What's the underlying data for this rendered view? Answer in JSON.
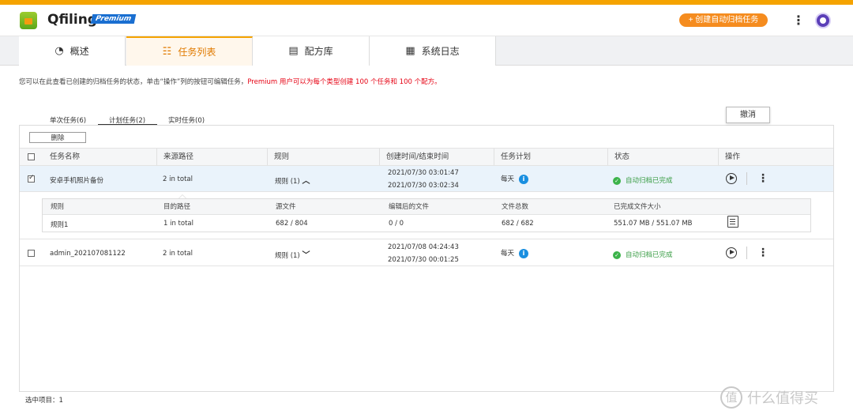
{
  "header": {
    "app_name": "Qfiling",
    "badge": "Premium",
    "create_button": "+ 创建自动归档任务"
  },
  "tabs": [
    {
      "label": "概述",
      "icon": "gauge-icon"
    },
    {
      "label": "任务列表",
      "icon": "task-list-icon",
      "active": true
    },
    {
      "label": "配方库",
      "icon": "recipe-library-icon"
    },
    {
      "label": "系统日志",
      "icon": "log-icon"
    }
  ],
  "description": {
    "normal": "您可以在此查看已创建的归档任务的状态，单击“操作”列的按钮可编辑任务，",
    "highlight": "Premium 用户可以为每个类型创建 100 个任务和 100 个配方。"
  },
  "subtabs": [
    {
      "label": "单次任务(6)"
    },
    {
      "label": "计划任务(2)",
      "active": true
    },
    {
      "label": "实时任务(0)"
    }
  ],
  "toolbar": {
    "delete_label": "删除"
  },
  "table": {
    "headers": [
      "任务名称",
      "来源路径",
      "规则",
      "创建时间/结束时间",
      "任务计划",
      "状态",
      "操作"
    ],
    "rows": [
      {
        "checked": true,
        "name": "安卓手机照片备份",
        "source": "2 in total",
        "rule": "规则 (1)",
        "expanded": true,
        "created": "2021/07/30 03:01:47",
        "ended": "2021/07/30 03:02:34",
        "schedule": "每天",
        "status": "自动归档已完成"
      },
      {
        "checked": false,
        "name": "admin_202107081122",
        "source": "2 in total",
        "rule": "规则 (1)",
        "expanded": false,
        "created": "2021/07/08 04:24:43",
        "ended": "2021/07/30 00:01:25",
        "schedule": "每天",
        "status": "自动归档已完成"
      }
    ]
  },
  "detail": {
    "headers": [
      "规则",
      "目的路径",
      "源文件",
      "编辑后的文件",
      "文件总数",
      "已完成文件大小"
    ],
    "row": [
      "规则1",
      "1 in total",
      "682 / 804",
      "0 / 0",
      "682 / 682",
      "551.07 MB / 551.07 MB"
    ]
  },
  "tooltip": "撤消",
  "footer": "选中项目：1",
  "watermark": "什么值得买",
  "colors": {
    "accent": "#f5a300",
    "button": "#f58c1f",
    "success": "#3a9d45",
    "info": "#1a8fe0",
    "warning_text": "#e60012"
  }
}
